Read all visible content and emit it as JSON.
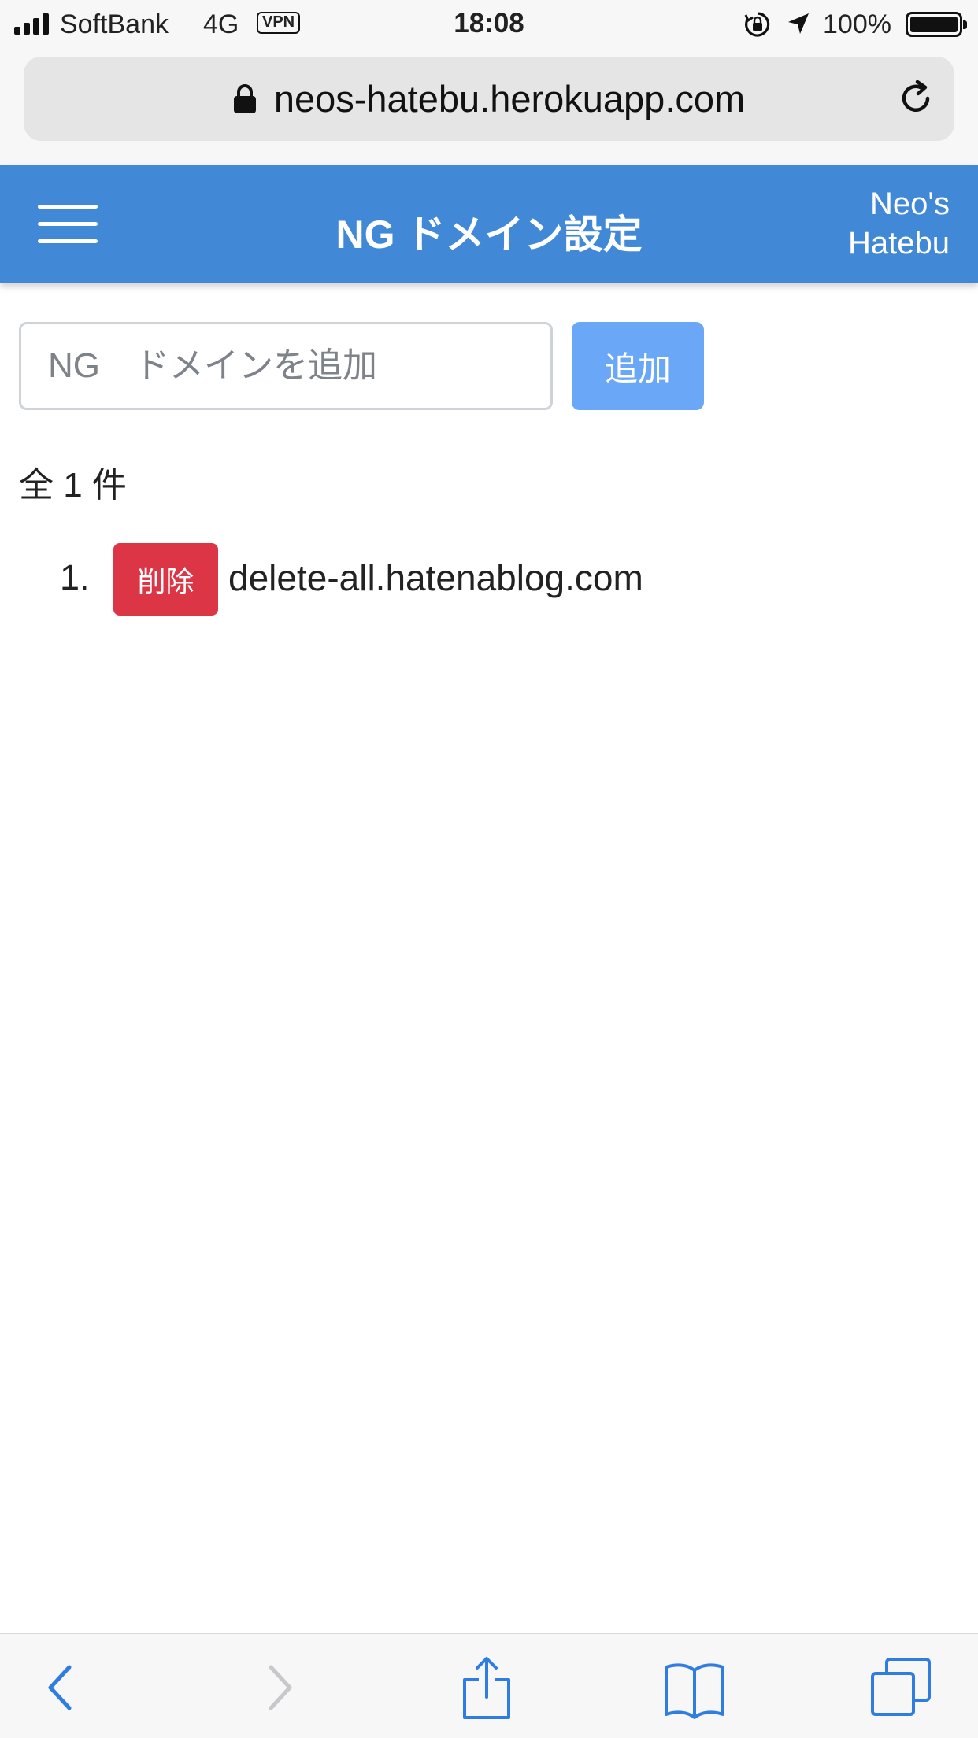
{
  "status_bar": {
    "carrier": "SoftBank",
    "network": "4G",
    "vpn": "VPN",
    "time": "18:08",
    "battery": "100%"
  },
  "browser": {
    "url": "neos-hatebu.herokuapp.com"
  },
  "header": {
    "title": "NG ドメイン設定",
    "brand_line1": "Neo's",
    "brand_line2": "Hatebu"
  },
  "form": {
    "input_placeholder": "NG　ドメインを追加",
    "add_label": "追加"
  },
  "list": {
    "total": "全 1 件",
    "items": [
      {
        "index": "1.",
        "delete_label": "削除",
        "domain": "delete-all.hatenablog.com"
      }
    ]
  },
  "colors": {
    "header_bg": "#4189d6",
    "add_button": "#6aa8f7",
    "delete_button": "#dc3545",
    "toolbar_icon": "#2f7de1",
    "toolbar_icon_disabled": "#c7c7cc"
  },
  "toolbar": {
    "icons": [
      "back-icon",
      "forward-icon",
      "share-icon",
      "bookmarks-icon",
      "tabs-icon"
    ]
  }
}
